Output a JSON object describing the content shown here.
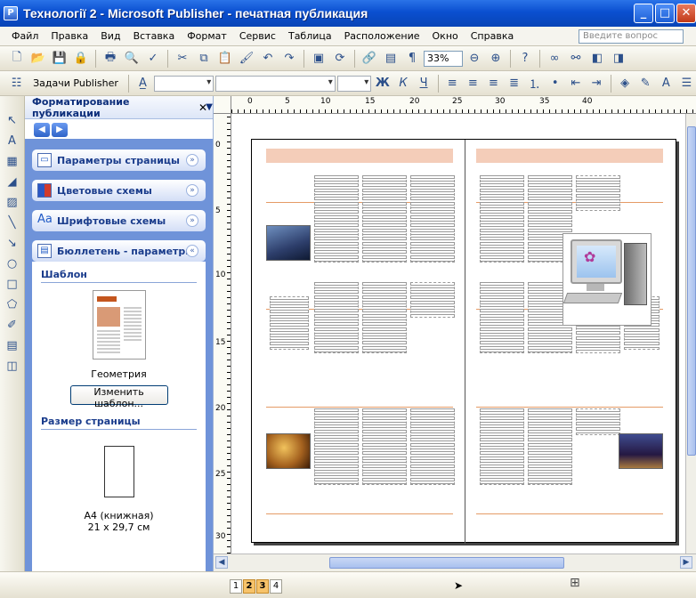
{
  "window": {
    "title": "Технологiї 2 - Microsoft Publisher - печатная публикация",
    "app_icon_letter": "P"
  },
  "menu": {
    "items": [
      "Файл",
      "Правка",
      "Вид",
      "Вставка",
      "Формат",
      "Сервис",
      "Таблица",
      "Расположение",
      "Окно",
      "Справка"
    ],
    "help_placeholder": "Введите вопрос"
  },
  "toolbar": {
    "zoom": "33%",
    "tasks_label": "Задачи Publisher"
  },
  "taskpane": {
    "title": "Форматирование публикации",
    "sections": [
      {
        "label": "Параметры страницы",
        "icon": "page-setup-icon"
      },
      {
        "label": "Цветовые схемы",
        "icon": "color-scheme-icon"
      },
      {
        "label": "Шрифтовые схемы",
        "icon": "font-scheme-icon",
        "icon_text": "Aa"
      },
      {
        "label": "Бюллетень - параметры",
        "icon": "newsletter-options-icon"
      }
    ],
    "template_heading": "Шаблон",
    "template_name": "Геометрия",
    "change_template_button": "Изменить шаблон...",
    "page_size_heading": "Размер страницы",
    "page_size_name": "А4 (книжная)",
    "page_size_dims": "21 x 29,7 см"
  },
  "ruler": {
    "top_labels": [
      "0",
      "5",
      "10",
      "15",
      "20",
      "25",
      "30",
      "35",
      "40"
    ],
    "left_labels": [
      "0",
      "5",
      "10",
      "15",
      "20",
      "25",
      "30"
    ]
  },
  "status": {
    "pages": [
      "1",
      "2",
      "3",
      "4"
    ],
    "active_pages": [
      "2",
      "3"
    ]
  },
  "colors": {
    "title_bar": "#0a4fd0",
    "taskpane_bg": "#6f93d9",
    "header_band": "#f4cdb9",
    "accent_orange": "#c45a1d"
  }
}
